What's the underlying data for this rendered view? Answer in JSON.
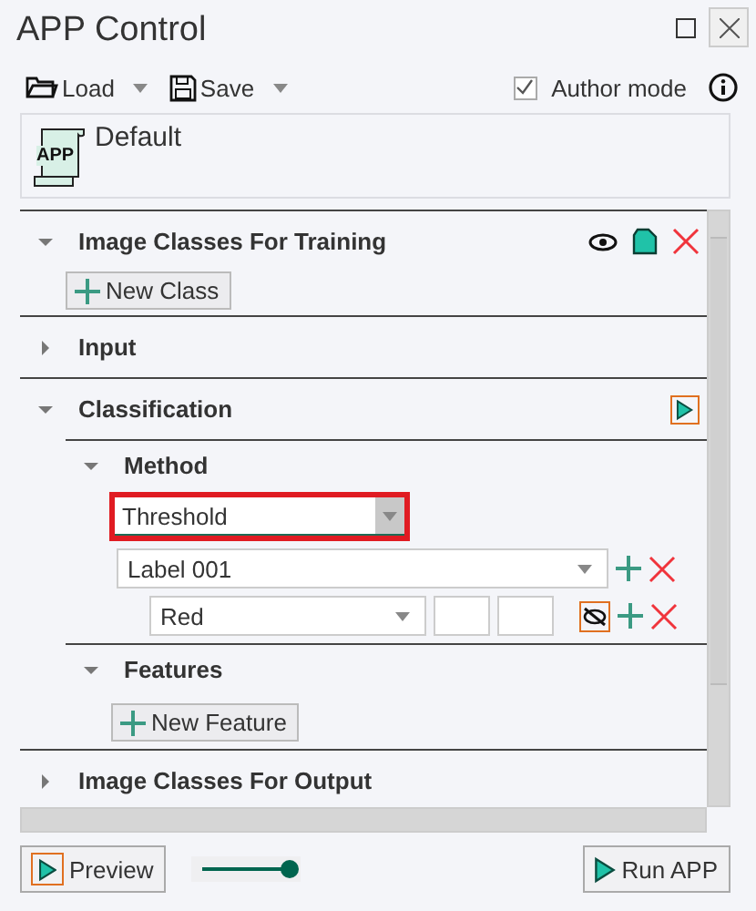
{
  "window": {
    "title": "APP Control"
  },
  "toolbar": {
    "load": "Load",
    "save": "Save",
    "author_mode": {
      "label": "Author mode",
      "checked": true
    }
  },
  "preset": {
    "name": "Default",
    "icon_text": "APP"
  },
  "sections": [
    {
      "title": "Image Classes For Training",
      "expanded": true,
      "kind": "classes",
      "button": "New Class"
    },
    {
      "title": "Input",
      "expanded": false,
      "kind": "plain"
    },
    {
      "title": "Classification",
      "expanded": true,
      "kind": "classification",
      "subsections": [
        {
          "title": "Method",
          "expanded": true,
          "kind": "method",
          "method": "Threshold",
          "label": "Label 001",
          "channel": "Red"
        },
        {
          "title": "Features",
          "expanded": true,
          "kind": "features",
          "button": "New Feature"
        }
      ]
    },
    {
      "title": "Image Classes For Output",
      "expanded": false,
      "kind": "plain"
    }
  ],
  "footer": {
    "preview": "Preview",
    "slider": {
      "level": 1
    },
    "run": "Run APP"
  }
}
